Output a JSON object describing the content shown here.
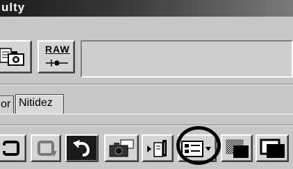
{
  "window": {
    "title": "ulty"
  },
  "toolbar": {
    "raw_label": "RAW",
    "camera_icon": "camera-with-document-icon",
    "raw_icon": "raw-settings-icon"
  },
  "tabs": [
    {
      "label": "or"
    },
    {
      "label": "Nitidez"
    }
  ],
  "bottom_toolbar": {
    "icons": [
      "rotate-left-icon",
      "rotate-right-icon",
      "undo-icon",
      "camera-icon",
      "export-icon",
      "thumbnail-view-icon",
      "pattern-view-icon",
      "dark-view-icon"
    ],
    "highlighted": "thumbnail-view-icon"
  }
}
